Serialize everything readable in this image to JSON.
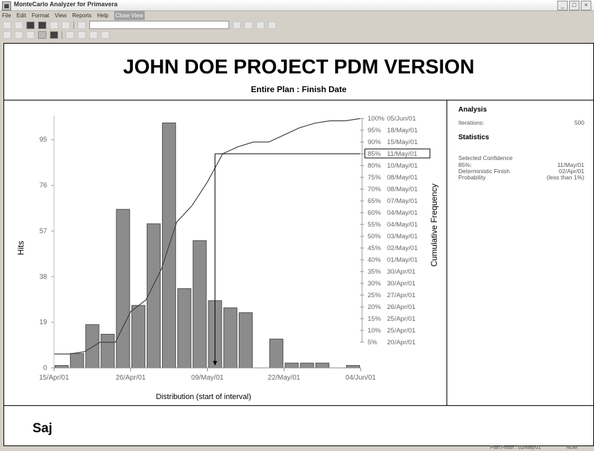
{
  "window": {
    "title": "MonteCarlo Analyzer for Primavera",
    "controls": [
      "_",
      "□",
      "×"
    ]
  },
  "menu": [
    "File",
    "Edit",
    "Format",
    "View",
    "Reports",
    "Help",
    "Close View"
  ],
  "report": {
    "title": "JOHN DOE PROJECT PDM VERSION",
    "subtitle": "Entire Plan : Finish Date",
    "footer_name": "Saj"
  },
  "side_panel": {
    "analysis_heading": "Analysis",
    "iterations_label": "Iterations:",
    "iterations_value": "500",
    "statistics_heading": "Statistics",
    "selected_confidence_label": "Selected Confidence",
    "confidence_pct": "85%:",
    "confidence_date": "11/May/01",
    "deterministic_label": "Deterministic Finish",
    "deterministic_date": "02/Apr/01",
    "probability_label": "Probability",
    "probability_value": "(less than 1%)"
  },
  "status": {
    "left": "Plan Finish : 02/May/01",
    "right": "NUM"
  },
  "chart_data": {
    "type": "bar",
    "xlabel": "Distribution (start of interval)",
    "ylabel": "Hits",
    "y2label": "Cumulative Frequency",
    "x_tick_labels": [
      "15/Apr/01",
      "26/Apr/01",
      "09/May/01",
      "22/May/01",
      "04/Jun/01"
    ],
    "y_ticks": [
      0,
      19,
      38,
      57,
      76,
      95
    ],
    "ylim": [
      0,
      105
    ],
    "values": [
      1,
      6,
      18,
      14,
      66,
      26,
      60,
      102,
      33,
      53,
      28,
      25,
      23,
      0,
      12,
      2,
      2,
      2,
      0,
      1
    ],
    "cumulative_pct": [
      0,
      1,
      5,
      5,
      18,
      23,
      36,
      56,
      63,
      73,
      85,
      88,
      90,
      90,
      93,
      96,
      98,
      99,
      99,
      100
    ],
    "right_axis": [
      {
        "pct": "100%",
        "date": "05/Jun/01"
      },
      {
        "pct": "95%",
        "date": "18/May/01"
      },
      {
        "pct": "90%",
        "date": "15/May/01"
      },
      {
        "pct": "85%",
        "date": "11/May/01"
      },
      {
        "pct": "80%",
        "date": "10/May/01"
      },
      {
        "pct": "75%",
        "date": "08/May/01"
      },
      {
        "pct": "70%",
        "date": "08/May/01"
      },
      {
        "pct": "65%",
        "date": "07/May/01"
      },
      {
        "pct": "60%",
        "date": "04/May/01"
      },
      {
        "pct": "55%",
        "date": "04/May/01"
      },
      {
        "pct": "50%",
        "date": "03/May/01"
      },
      {
        "pct": "45%",
        "date": "02/May/01"
      },
      {
        "pct": "40%",
        "date": "01/May/01"
      },
      {
        "pct": "35%",
        "date": "30/Apr/01"
      },
      {
        "pct": "30%",
        "date": "30/Apr/01"
      },
      {
        "pct": "25%",
        "date": "27/Apr/01"
      },
      {
        "pct": "20%",
        "date": "26/Apr/01"
      },
      {
        "pct": "15%",
        "date": "25/Apr/01"
      },
      {
        "pct": "10%",
        "date": "25/Apr/01"
      },
      {
        "pct": "5%",
        "date": "20/Apr/01"
      }
    ],
    "selected_confidence": {
      "pct": 85,
      "label": "85%",
      "date": "11/May/01",
      "bar_index": 10
    },
    "colors": {
      "bar": "#8c8c8c",
      "bar_stroke": "#505050",
      "line": "#404040"
    }
  }
}
